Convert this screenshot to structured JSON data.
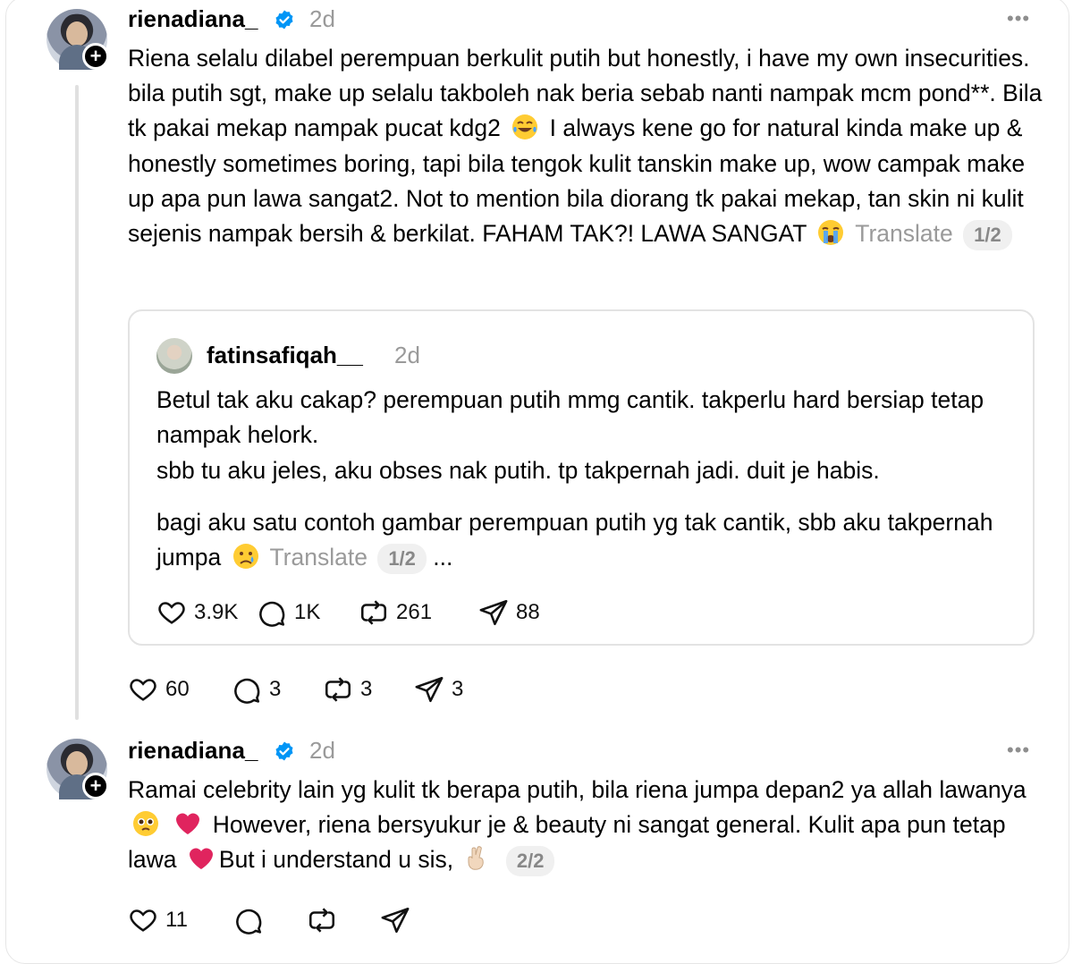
{
  "post1": {
    "username": "rienadiana_",
    "time": "2d",
    "more": "•••",
    "text_before_emoji1": "Riena selalu dilabel perempuan berkulit putih but honestly, i have my own insecurities. bila putih sgt, make up selalu takboleh nak beria sebab nanti nampak mcm pond**. Bila tk pakai mekap nampak pucat kdg2",
    "text_after_emoji1": "I always kene go for natural kinda make up & honestly sometimes boring, tapi bila tengok kulit tanskin make up, wow campak make up apa pun lawa sangat2. Not to mention bila diorang tk pakai mekap, tan skin ni kulit sejenis nampak bersih & berkilat. FAHAM TAK?! LAWA SANGAT",
    "translate": "Translate",
    "pager": "1/2",
    "stats": {
      "likes": "60",
      "replies": "3",
      "reposts": "3",
      "shares": "3"
    }
  },
  "quote": {
    "username": "fatinsafiqah__",
    "time": "2d",
    "line1": "Betul tak aku cakap? perempuan putih mmg cantik. takperlu hard bersiap tetap nampak helork.",
    "line2": "sbb tu aku jeles, aku obses nak putih. tp takpernah jadi. duit je habis.",
    "line3": "bagi aku satu contoh gambar perempuan putih yg tak cantik, sbb aku takpernah jumpa",
    "translate": "Translate",
    "pager": "1/2",
    "ellipsis": "...",
    "stats": {
      "likes": "3.9K",
      "replies": "1K",
      "reposts": "261",
      "shares": "88"
    }
  },
  "post2": {
    "username": "rienadiana_",
    "time": "2d",
    "more": "•••",
    "text_part1": "Ramai celebrity lain yg kulit tk berapa putih, bila riena jumpa depan2 ya allah lawanya",
    "text_part2": "However, riena bersyukur je & beauty ni sangat general. Kulit apa pun tetap lawa",
    "text_part3": "But i understand u sis,",
    "pager": "2/2",
    "stats": {
      "likes": "11"
    }
  },
  "icons": {
    "verified": "verified-badge-icon",
    "like": "heart-icon",
    "reply": "comment-icon",
    "repost": "repost-icon",
    "share": "send-icon",
    "follow": "plus-icon"
  },
  "colors": {
    "verified": "#0095f6",
    "muted": "#9a9a9a",
    "border": "#e3e3e3",
    "heart": "#e0245e"
  }
}
